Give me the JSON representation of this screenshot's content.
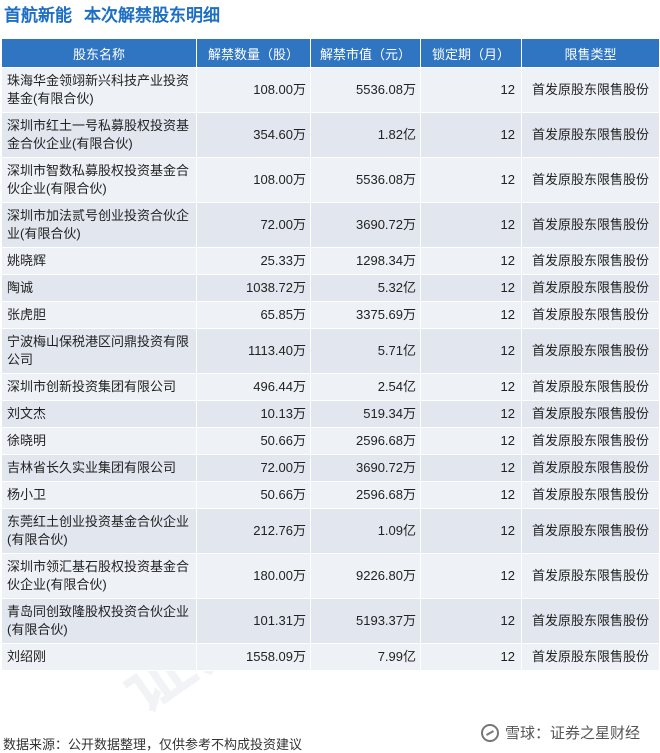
{
  "title": {
    "company": "首航新能",
    "subtitle": "本次解禁股东明细"
  },
  "table": {
    "headers": [
      "股东名称",
      "解禁数量（股）",
      "解禁市值（元）",
      "锁定期（月）",
      "限售类型"
    ],
    "rows": [
      {
        "name": "珠海华金领翊新兴科技产业投资基金(有限合伙)",
        "qty": "108.00万",
        "value": "5536.08万",
        "lock": "12",
        "type": "首发原股东限售股份",
        "tall": true
      },
      {
        "name": "深圳市红土一号私募股权投资基金合伙企业(有限合伙)",
        "qty": "354.60万",
        "value": "1.82亿",
        "lock": "12",
        "type": "首发原股东限售股份",
        "tall": true
      },
      {
        "name": "深圳市智数私募股权投资基金合伙企业(有限合伙)",
        "qty": "108.00万",
        "value": "5536.08万",
        "lock": "12",
        "type": "首发原股东限售股份",
        "tall": true
      },
      {
        "name": "深圳市加法贰号创业投资合伙企业(有限合伙)",
        "qty": "72.00万",
        "value": "3690.72万",
        "lock": "12",
        "type": "首发原股东限售股份",
        "tall": true
      },
      {
        "name": "姚晓辉",
        "qty": "25.33万",
        "value": "1298.34万",
        "lock": "12",
        "type": "首发原股东限售股份",
        "tall": false
      },
      {
        "name": "陶诚",
        "qty": "1038.72万",
        "value": "5.32亿",
        "lock": "12",
        "type": "首发原股东限售股份",
        "tall": false
      },
      {
        "name": "张虎胆",
        "qty": "65.85万",
        "value": "3375.69万",
        "lock": "12",
        "type": "首发原股东限售股份",
        "tall": false
      },
      {
        "name": "宁波梅山保税港区问鼎投资有限公司",
        "qty": "1113.40万",
        "value": "5.71亿",
        "lock": "12",
        "type": "首发原股东限售股份",
        "tall": true
      },
      {
        "name": "深圳市创新投资集团有限公司",
        "qty": "496.44万",
        "value": "2.54亿",
        "lock": "12",
        "type": "首发原股东限售股份",
        "tall": false
      },
      {
        "name": "刘文杰",
        "qty": "10.13万",
        "value": "519.34万",
        "lock": "12",
        "type": "首发原股东限售股份",
        "tall": false
      },
      {
        "name": "徐晓明",
        "qty": "50.66万",
        "value": "2596.68万",
        "lock": "12",
        "type": "首发原股东限售股份",
        "tall": false
      },
      {
        "name": "吉林省长久实业集团有限公司",
        "qty": "72.00万",
        "value": "3690.72万",
        "lock": "12",
        "type": "首发原股东限售股份",
        "tall": false
      },
      {
        "name": "杨小卫",
        "qty": "50.66万",
        "value": "2596.68万",
        "lock": "12",
        "type": "首发原股东限售股份",
        "tall": false
      },
      {
        "name": "东莞红土创业投资基金合伙企业(有限合伙)",
        "qty": "212.76万",
        "value": "1.09亿",
        "lock": "12",
        "type": "首发原股东限售股份",
        "tall": true
      },
      {
        "name": "深圳市领汇基石股权投资基金合伙企业(有限合伙)",
        "qty": "180.00万",
        "value": "9226.80万",
        "lock": "12",
        "type": "首发原股东限售股份",
        "tall": true
      },
      {
        "name": "青岛同创致隆股权投资合伙企业(有限合伙)",
        "qty": "101.31万",
        "value": "5193.37万",
        "lock": "12",
        "type": "首发原股东限售股份",
        "tall": true
      },
      {
        "name": "刘绍刚",
        "qty": "1558.09万",
        "value": "7.99亿",
        "lock": "12",
        "type": "首发原股东限售股份",
        "tall": false
      }
    ]
  },
  "footer": {
    "source": "数据来源：公开数据整理，仅供参考不构成投资建议"
  },
  "brand": {
    "text": "雪球：证券之星财经",
    "icon": "snowball-logo-icon"
  },
  "watermark": {
    "text": "证券之星"
  },
  "colors": {
    "title": "#1d6fc4",
    "header_bg": "#2f75c2",
    "row_odd": "#eef1f6",
    "row_even": "#e1e6ef"
  }
}
